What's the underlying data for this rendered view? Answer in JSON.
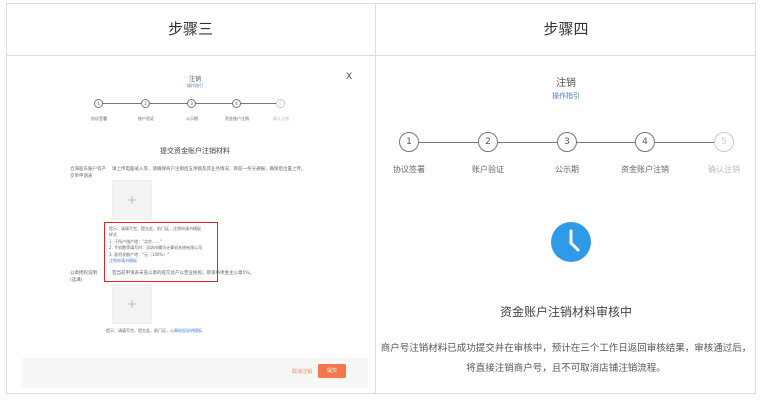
{
  "columns": {
    "left_header": "步骤三",
    "right_header": "步骤四"
  },
  "left": {
    "dialog_title": "注销",
    "dialog_subtitle": "操作指引",
    "close_glyph": "X",
    "steps": [
      {
        "n": "1",
        "label": "协议签署"
      },
      {
        "n": "2",
        "label": "账户验证"
      },
      {
        "n": "3",
        "label": "公示期"
      },
      {
        "n": "4",
        "label": "资金账户注销"
      },
      {
        "n": "5",
        "label": "确认注销"
      }
    ],
    "section_title": "提交资金账户注销材料",
    "field1_label_line1": "仓海股东账户资产",
    "field1_label_line2": "交单申请表",
    "field1_desc": "请上传电脑录入等，请确保商户注销后五余额及其业务情况、目前一条分通报，确保后位置上传。",
    "upload_glyph": "+",
    "hint_lines": [
      "提示：请填写完，提交此，前门证，注销申请书模板",
      "样式",
      "1. 于所户指产地：\"北京……\"",
      "2. 手机数等填写时：深圳市腾讯计算机系统有限公司",
      "3. 面积发额产地：\"元（100%）\""
    ],
    "hint_link": "注销申请书模板",
    "field2_label_line1": "公章授权说明",
    "field2_label_line2": "(选填)",
    "field2_desc": "若当前申请表未盖公章的提交此产以营业执照，即请事项金主公章5%。",
    "tip2": "提示：请填写完，提交此，前门证，",
    "tip2_link": "公章授权说明模板",
    "cancel_label": "取消注销",
    "submit_label": "提交"
  },
  "right": {
    "dialog_title": "注销",
    "dialog_subtitle": "操作指引",
    "steps": [
      {
        "n": "1",
        "label": "协议签署"
      },
      {
        "n": "2",
        "label": "账户验证"
      },
      {
        "n": "3",
        "label": "公示期"
      },
      {
        "n": "4",
        "label": "资金账户注销"
      },
      {
        "n": "5",
        "label": "确认注销"
      }
    ],
    "status_title": "资金账户注销材料审核中",
    "desc_line1": "商户号注销材料已成功提交并在审核中，预计在三个工作日返回审核结果，审核通过后，",
    "desc_line2": "将直接注销商户号，且不可取消店铺注销流程。",
    "accent_color": "#2f9ae8"
  }
}
